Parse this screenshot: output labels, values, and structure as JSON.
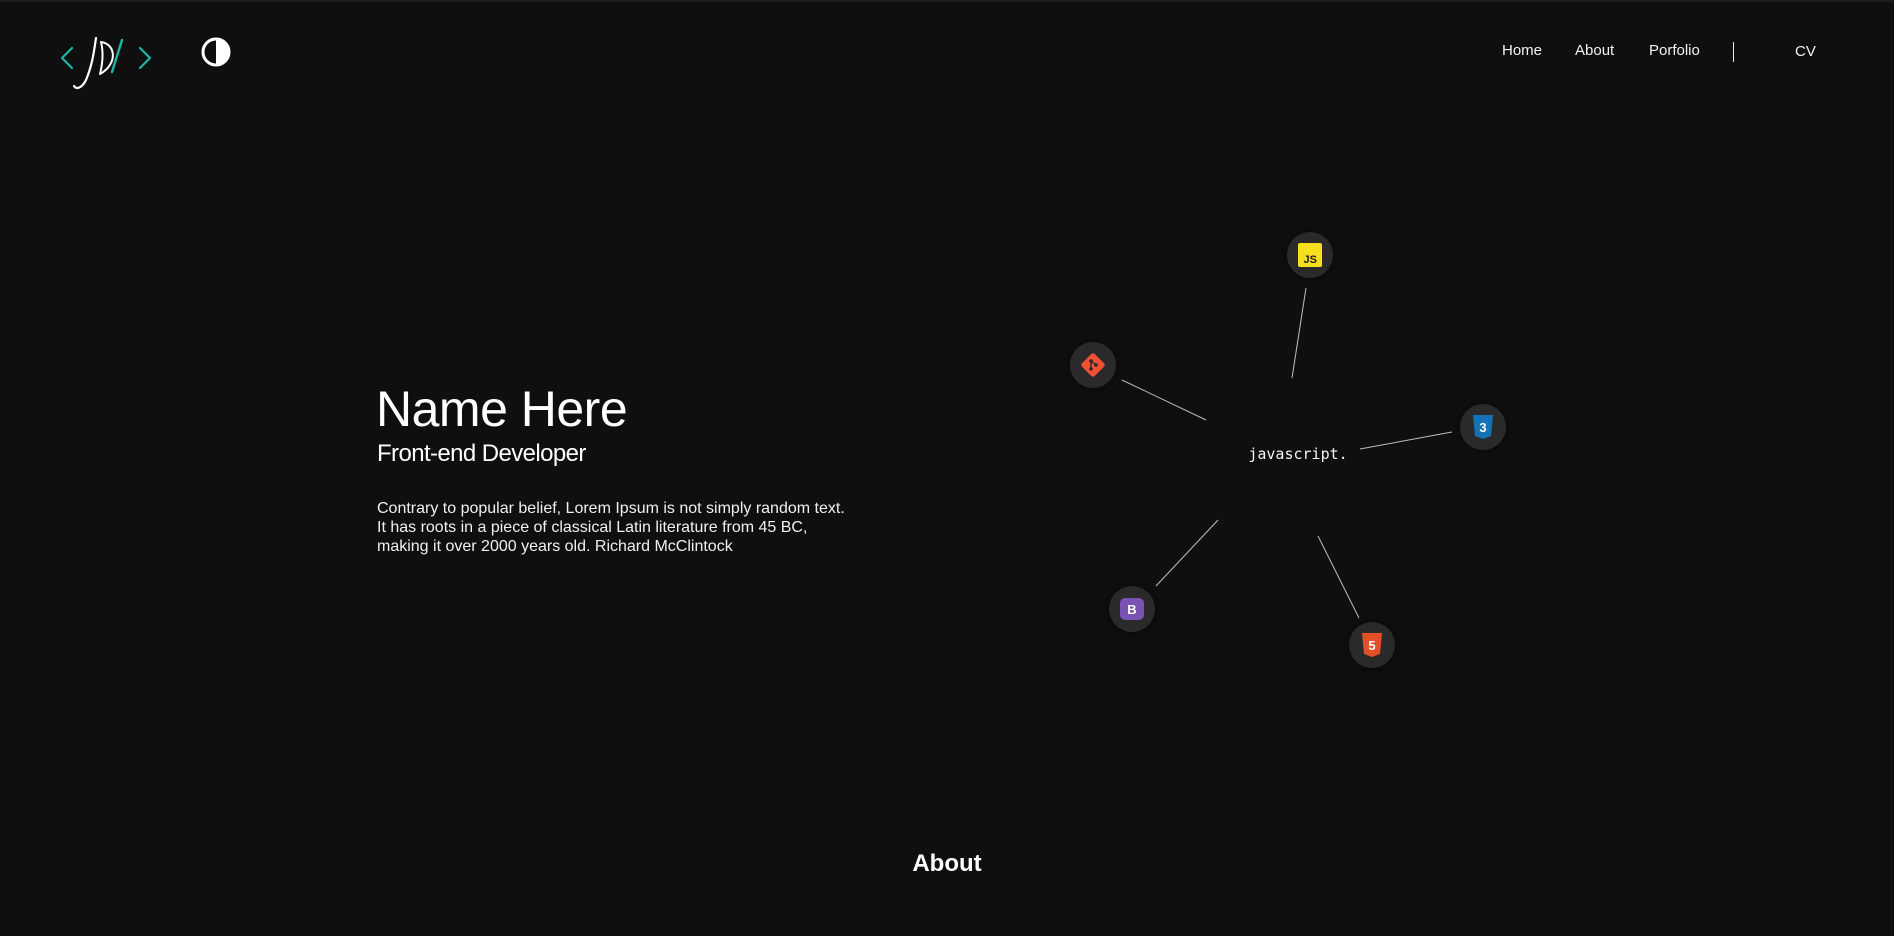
{
  "header": {
    "logo_icon": "jd-code-logo",
    "theme_toggle_icon": "contrast-icon",
    "nav": {
      "home": "Home",
      "about": "About",
      "portfolio": "Porfolio",
      "cv": "CV"
    }
  },
  "hero": {
    "name": "Name Here",
    "role": "Front-end Developer",
    "description_lines": [
      "Contrary to popular belief, Lorem Ipsum is not simply random text.",
      "It has roots in a piece of classical Latin literature from 45 BC,",
      "making it over 2000 years old. Richard McClintock"
    ]
  },
  "skills": {
    "center_word": "javascript.",
    "nodes": [
      {
        "name": "javascript",
        "icon": "javascript-icon",
        "label": "JS",
        "color": "#f7df1e"
      },
      {
        "name": "git",
        "icon": "git-icon",
        "color": "#f05033"
      },
      {
        "name": "css3",
        "icon": "css3-icon",
        "label": "3",
        "color": "#1572b6"
      },
      {
        "name": "bootstrap",
        "icon": "bootstrap-icon",
        "label": "B",
        "color": "#7952b3"
      },
      {
        "name": "html5",
        "icon": "html5-icon",
        "label": "5",
        "color": "#e34f26"
      }
    ]
  },
  "about": {
    "heading": "About"
  },
  "colors": {
    "background": "#0f0f0f",
    "accent_teal": "#1fb6a8",
    "node_bg": "#2a2a2a"
  }
}
